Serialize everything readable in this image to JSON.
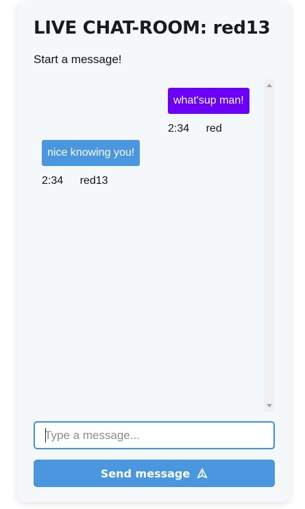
{
  "header": {
    "title": "LIVE CHAT-ROOM: red13",
    "subtitle": "Start a message!"
  },
  "messages": [
    {
      "text": "what'sup man!",
      "time": "2:34",
      "user": "red",
      "direction": "sent",
      "color": "#6a00f5"
    },
    {
      "text": "nice knowing you!",
      "time": "2:34",
      "user": "red13",
      "direction": "received",
      "color": "#4a97e0"
    }
  ],
  "composer": {
    "placeholder": "Type a message...",
    "value": "",
    "send_label": "Send message",
    "send_icon": "send-icon"
  },
  "colors": {
    "accent": "#4a97e0",
    "sent_bubble": "#6a00f5",
    "card_bg": "#f4f8fb"
  }
}
